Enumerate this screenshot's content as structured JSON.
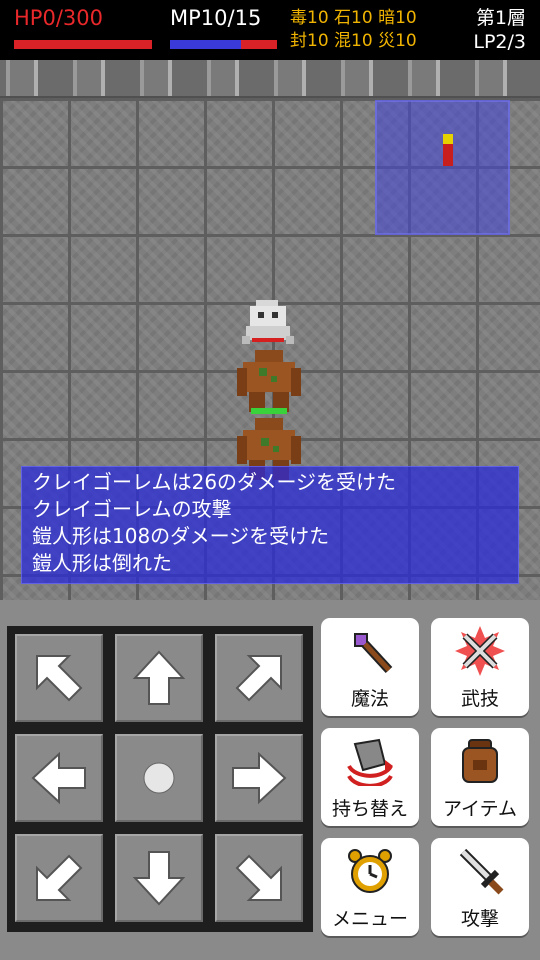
{
  "hud": {
    "hp_label": "HP0/300",
    "hp_current": 0,
    "hp_max": 300,
    "mp_label": "MP10/15",
    "mp_current": 10,
    "mp_max": 15,
    "status_line1": "毒10 石10 暗10",
    "status_line2": "封10 混10 災10",
    "floor": "第1層",
    "lp": "LP2/3",
    "colors": {
      "hp": "#e8282a",
      "mp": "#3a3ad9",
      "status": "#f0b400"
    }
  },
  "map": {
    "sprites": [
      "ghost-sprite",
      "clay-golem-sprite",
      "armor-doll-sprite"
    ]
  },
  "message_log": [
    "クレイゴーレムは26のダメージを受けた",
    "クレイゴーレムの攻撃",
    "鎧人形は108のダメージを受けた",
    "鎧人形は倒れた"
  ],
  "dpad": {
    "buttons": [
      "arrow-up-left-icon",
      "arrow-up-icon",
      "arrow-up-right-icon",
      "arrow-left-icon",
      "wait-dot-icon",
      "arrow-right-icon",
      "arrow-down-left-icon",
      "arrow-down-icon",
      "arrow-down-right-icon"
    ]
  },
  "actions": {
    "magic": {
      "label": "魔法",
      "icon": "staff-icon"
    },
    "skill": {
      "label": "武技",
      "icon": "crossed-swords-icon"
    },
    "swap": {
      "label": "持ち替え",
      "icon": "swap-weapon-icon"
    },
    "item": {
      "label": "アイテム",
      "icon": "bag-icon"
    },
    "menu": {
      "label": "メニュー",
      "icon": "alarm-clock-icon"
    },
    "attack": {
      "label": "攻撃",
      "icon": "sword-icon"
    }
  }
}
